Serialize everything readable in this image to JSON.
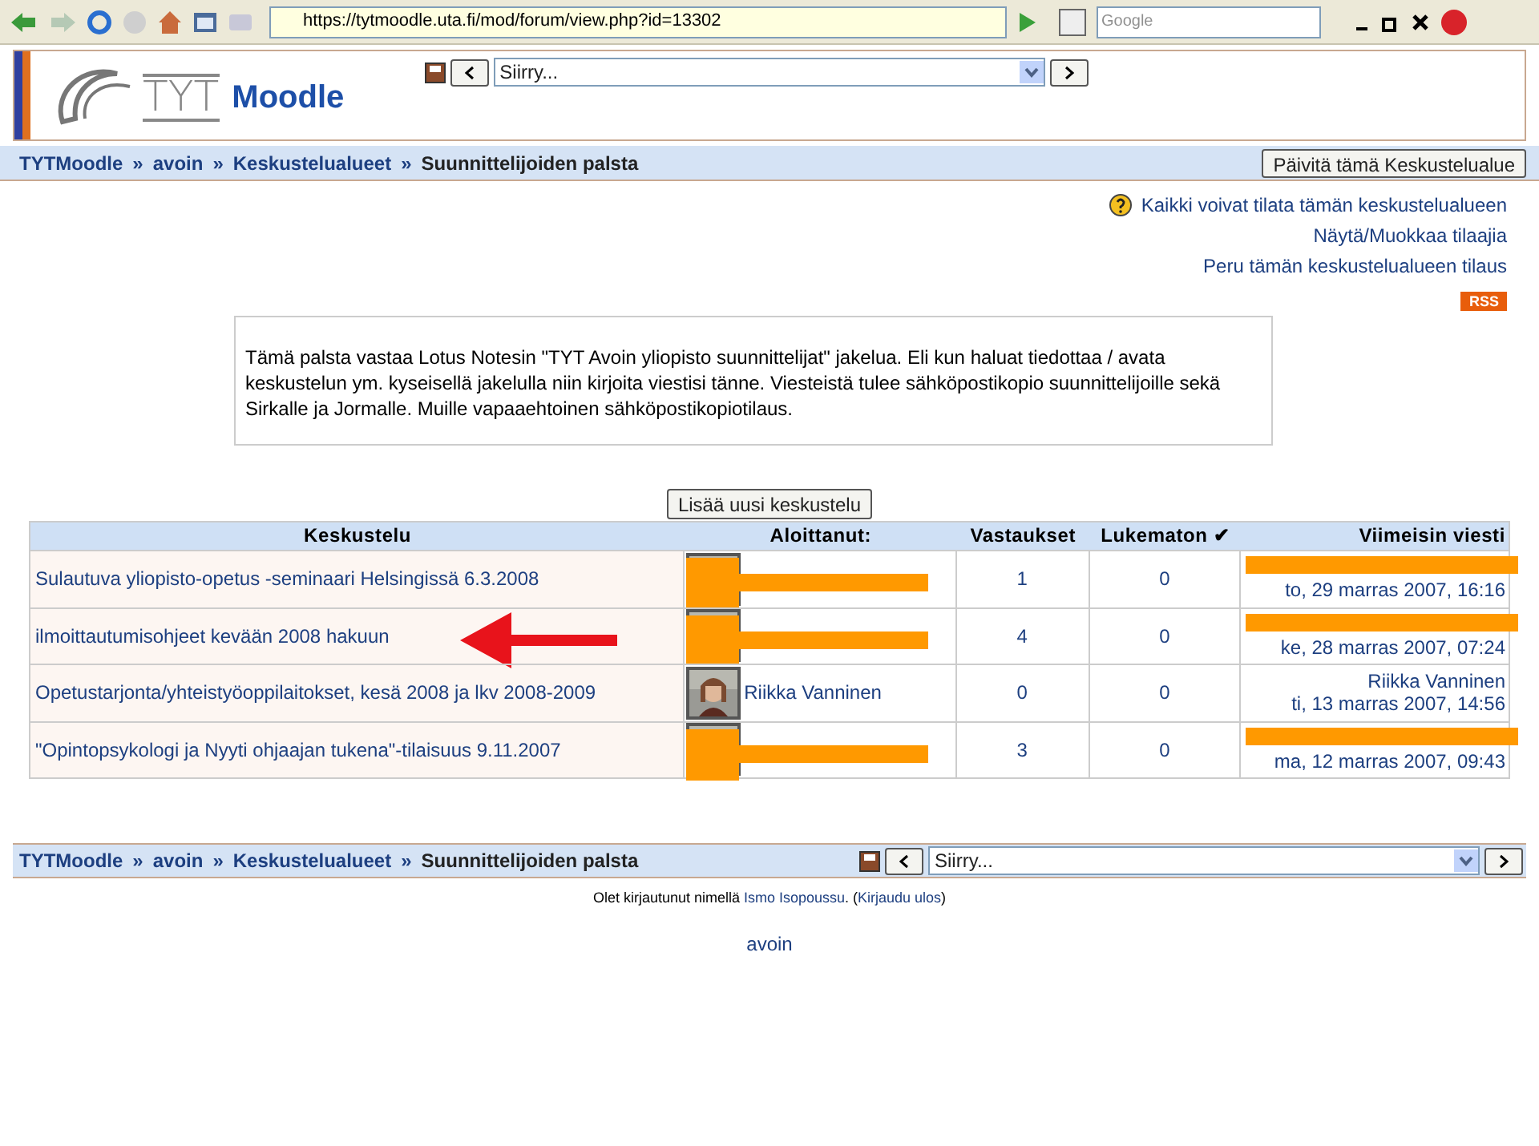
{
  "browser": {
    "url": "https://tytmoodle.uta.fi/mod/forum/view.php?id=13302",
    "search_placeholder": "Google"
  },
  "header": {
    "logo_mark": "TYT",
    "logo_name": "Moodle",
    "jump_select": "Siirry..."
  },
  "breadcrumb": {
    "separator": "»",
    "items": [
      "TYTMoodle",
      "avoin",
      "Keskustelualueet",
      "Suunnittelijoiden palsta"
    ]
  },
  "update_button": "Päivitä tämä Keskustelualue",
  "subscription_links": [
    "Kaikki voivat tilata tämän keskustelualueen",
    "Näytä/Muokkaa tilaajia",
    "Peru tämän keskustelualueen tilaus"
  ],
  "rss_badge": "RSS",
  "intro": "Tämä palsta vastaa Lotus Notesin \"TYT Avoin yliopisto suunnittelijat\" jakelua. Eli kun haluat tiedottaa / avata keskustelun ym.  kyseisellä jakelulla niin kirjoita viestisi tänne. Viesteistä tulee sähköpostikopio suunnittelijoille sekä Sirkalle ja Jormalle. Muille vapaaehtoinen sähköpostikopiotilaus.",
  "add_button": "Lisää uusi keskustelu",
  "table": {
    "columns": [
      "Keskustelu",
      "Aloittanut:",
      "Vastaukset",
      "Lukematon ✔",
      "Viimeisin viesti"
    ],
    "rows": [
      {
        "topic": "Sulautuva yliopisto-opetus -seminaari Helsingissä 6.3.2008",
        "starter": {
          "redacted": true
        },
        "replies": "1",
        "unread": "0",
        "last_post": {
          "redacted": true,
          "date": "to, 29 marras 2007, 16:16"
        },
        "arrow": false
      },
      {
        "topic": "ilmoittautumisohjeet kevään 2008 hakuun",
        "starter": {
          "redacted": true
        },
        "replies": "4",
        "unread": "0",
        "last_post": {
          "redacted": true,
          "date": "ke, 28 marras 2007, 07:24"
        },
        "arrow": true
      },
      {
        "topic": "Opetustarjonta/yhteistyöoppilaitokset, kesä 2008 ja lkv 2008-2009",
        "starter": {
          "redacted": false,
          "name": "Riikka Vanninen"
        },
        "replies": "0",
        "unread": "0",
        "last_post": {
          "redacted": false,
          "author": "Riikka Vanninen",
          "date": "ti, 13 marras 2007, 14:56"
        },
        "arrow": false
      },
      {
        "topic": "\"Opintopsykologi ja Nyyti ohjaajan tukena\"-tilaisuus 9.11.2007",
        "starter": {
          "redacted": true
        },
        "replies": "3",
        "unread": "0",
        "last_post": {
          "redacted": true,
          "date": "ma, 12 marras 2007, 09:43"
        },
        "arrow": false
      }
    ]
  },
  "bottom_nav": {
    "breadcrumb": {
      "separator": "»",
      "items": [
        "TYTMoodle",
        "avoin",
        "Keskustelualueet",
        "Suunnittelijoiden palsta"
      ]
    },
    "jump_select": "Siirry..."
  },
  "footer": {
    "logged_in_prefix": "Olet kirjautunut nimellä",
    "user": "Ismo Isopoussu",
    "user_suffix": ". (",
    "logout": "Kirjaudu ulos",
    "logout_suffix": ")",
    "course_link": "avoin"
  }
}
